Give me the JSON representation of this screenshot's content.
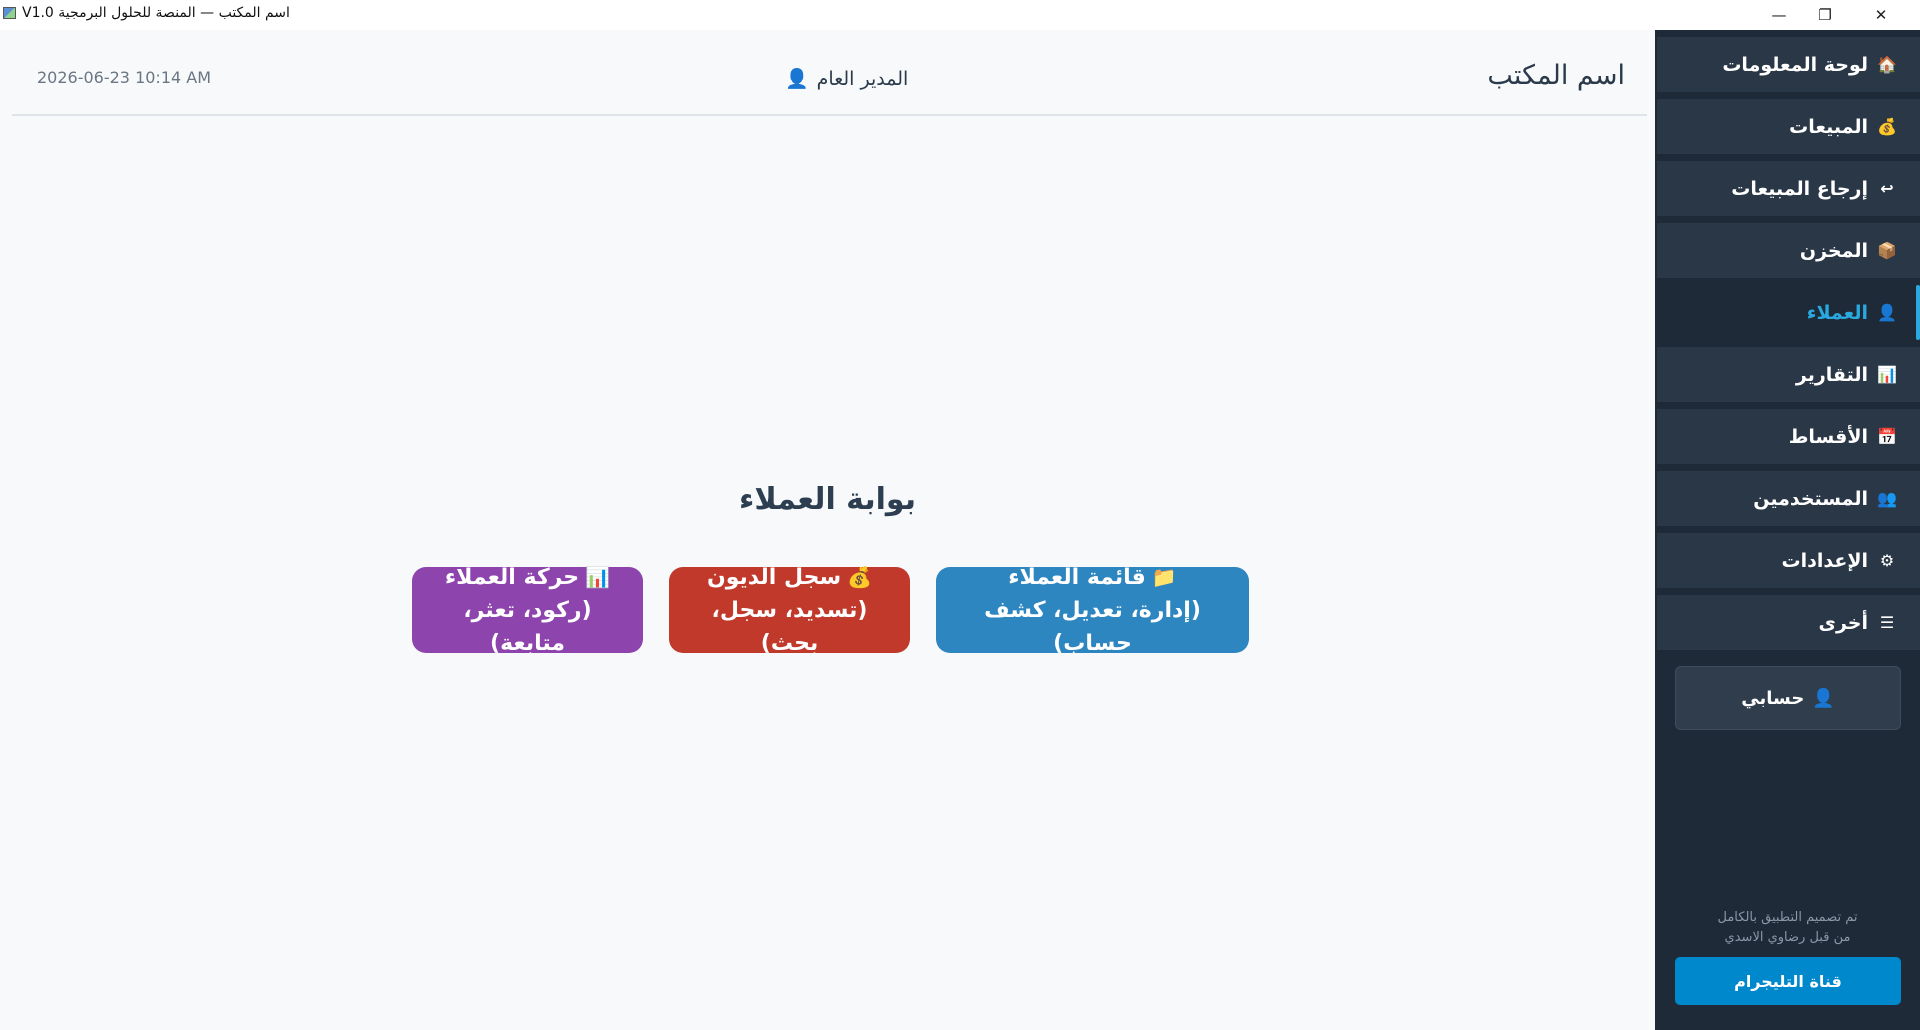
{
  "window": {
    "title": "V1.0 اسم المكتب — المنصة للحلول البرمجية",
    "minimize": "—",
    "restore": "❐",
    "close": "✕"
  },
  "header": {
    "datetime": "2026-06-23  10:14 AM",
    "user_icon": "👤",
    "user": "المدير العام",
    "office_name": "اسم المكتب"
  },
  "portal": {
    "title": "بوابة العملاء",
    "buttons": [
      {
        "icon": "📁",
        "label": "قائمة العملاء",
        "sub": "(إدارة، تعديل، كشف حساب)",
        "color": "#2e86c1"
      },
      {
        "icon": "💰",
        "label": "سجل الديون",
        "sub": "(تسديد، سجل، بحث)",
        "color": "#c0392b"
      },
      {
        "icon": "📊",
        "label": "حركة العملاء",
        "sub": "(ركود، تعثر، متابعة)",
        "color": "#8e44ad"
      }
    ]
  },
  "sidebar": {
    "items": [
      {
        "icon": "🏠",
        "label": "لوحة المعلومات"
      },
      {
        "icon": "💰",
        "label": "المبيعات"
      },
      {
        "icon": "↩",
        "label": "إرجاع المبيعات"
      },
      {
        "icon": "📦",
        "label": "المخزن"
      },
      {
        "icon": "👤",
        "label": "العملاء",
        "active": true
      },
      {
        "icon": "📊",
        "label": "التقارير"
      },
      {
        "icon": "📅",
        "label": "الأقساط"
      },
      {
        "icon": "👥",
        "label": "المستخدمين"
      },
      {
        "icon": "⚙",
        "label": "الإعدادات"
      },
      {
        "icon": "☰",
        "label": "أخرى"
      }
    ],
    "account": {
      "icon": "👤",
      "label": "حسابي"
    },
    "credit_line1": "تم تصميم التطبيق بالكامل",
    "credit_line2": "من قبل رضاوي الاسدي",
    "telegram": "قناة التليجرام",
    "accent_color": "#29a9e0"
  }
}
